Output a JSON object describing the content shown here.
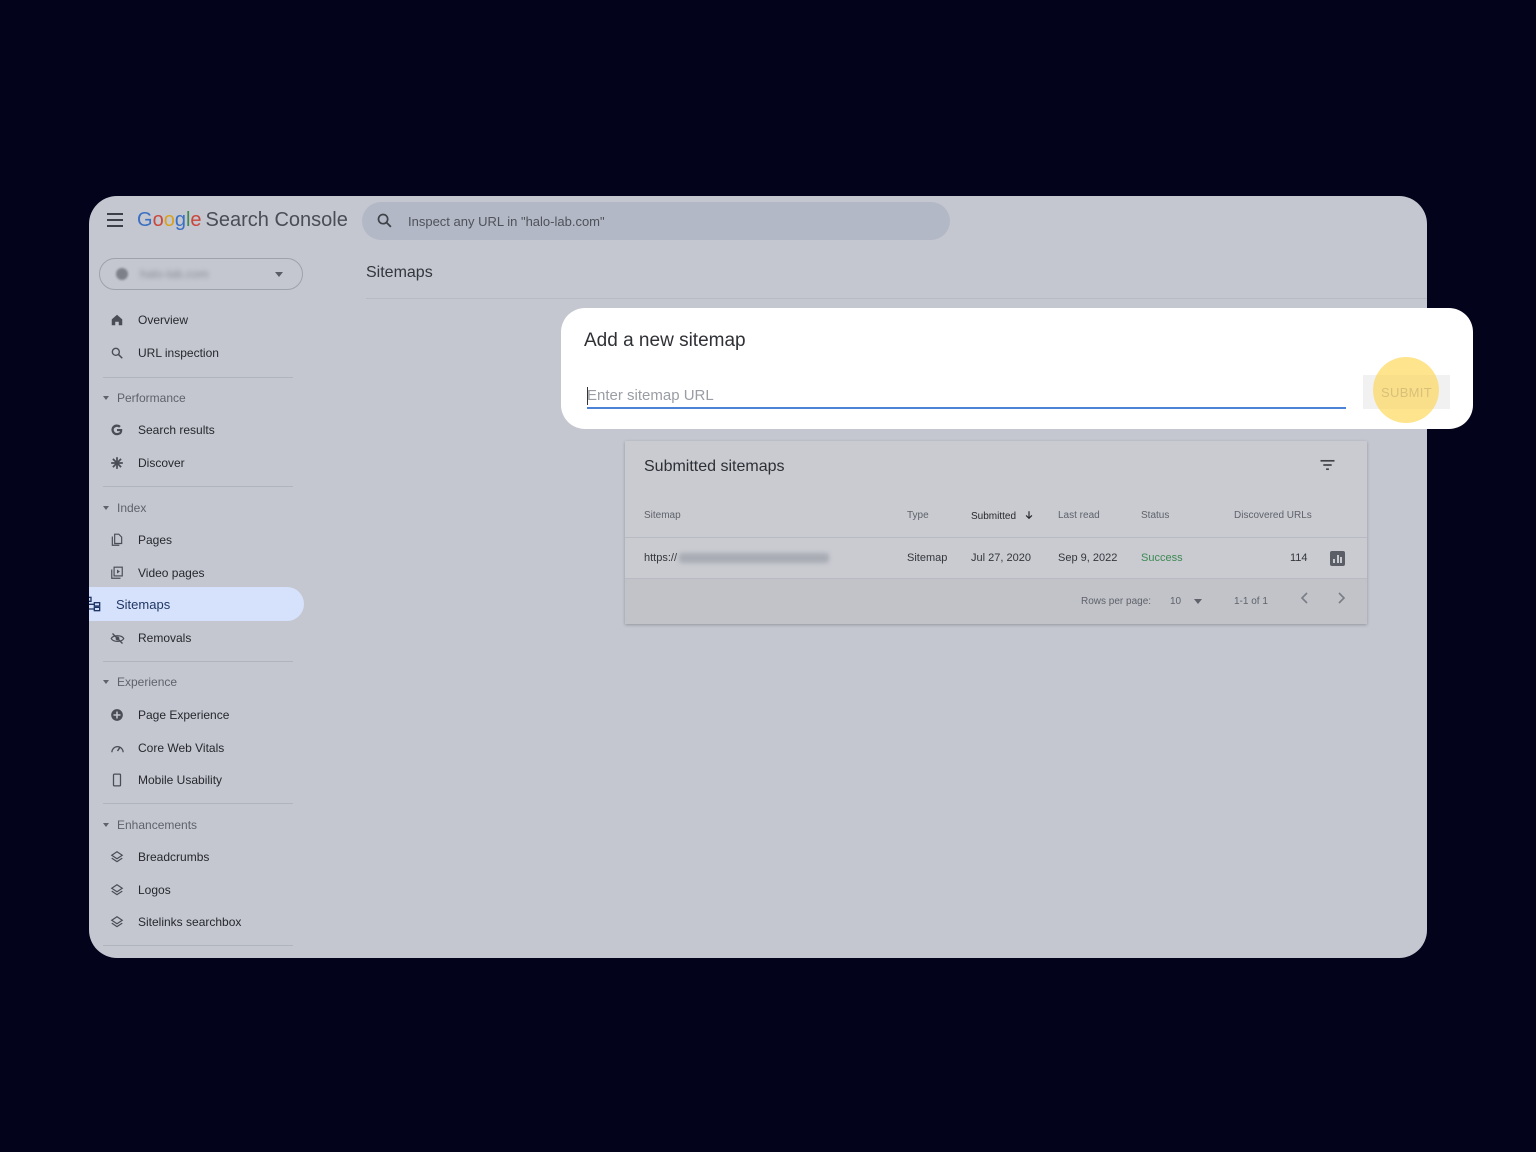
{
  "header": {
    "logo_google_letters": [
      "G",
      "o",
      "o",
      "g",
      "l",
      "e"
    ],
    "logo_product": "Search Console",
    "search_placeholder": "Inspect any URL in \"halo-lab.com\""
  },
  "property": {
    "domain": "halo-lab.com"
  },
  "sidebar": {
    "top_items": [
      {
        "label": "Overview",
        "icon": "home-icon"
      },
      {
        "label": "URL inspection",
        "icon": "search-icon"
      }
    ],
    "sections": [
      {
        "title": "Performance",
        "items": [
          {
            "label": "Search results",
            "icon": "google-g-icon"
          },
          {
            "label": "Discover",
            "icon": "asterisk-icon"
          }
        ]
      },
      {
        "title": "Index",
        "items": [
          {
            "label": "Pages",
            "icon": "pages-icon"
          },
          {
            "label": "Video pages",
            "icon": "video-pages-icon"
          },
          {
            "label": "Sitemaps",
            "icon": "sitemap-icon",
            "active": true
          },
          {
            "label": "Removals",
            "icon": "eye-off-icon"
          }
        ]
      },
      {
        "title": "Experience",
        "items": [
          {
            "label": "Page Experience",
            "icon": "plus-circle-icon"
          },
          {
            "label": "Core Web Vitals",
            "icon": "gauge-icon"
          },
          {
            "label": "Mobile Usability",
            "icon": "phone-icon"
          }
        ]
      },
      {
        "title": "Enhancements",
        "items": [
          {
            "label": "Breadcrumbs",
            "icon": "layers-icon"
          },
          {
            "label": "Logos",
            "icon": "layers-icon"
          },
          {
            "label": "Sitelinks searchbox",
            "icon": "layers-icon"
          }
        ]
      }
    ]
  },
  "main": {
    "page_title": "Sitemaps"
  },
  "dialog": {
    "title": "Add a new sitemap",
    "input_placeholder": "Enter sitemap URL",
    "input_value": "",
    "submit_label": "SUBMIT"
  },
  "submitted": {
    "title": "Submitted sitemaps",
    "columns": [
      "Sitemap",
      "Type",
      "Submitted",
      "Last read",
      "Status",
      "Discovered URLs"
    ],
    "rows": [
      {
        "sitemap": "https://",
        "type": "Sitemap",
        "submitted": "Jul 27, 2020",
        "last_read": "Sep 9, 2022",
        "status": "Success",
        "discovered": "114"
      }
    ],
    "rows_per_page_label": "Rows per page:",
    "rows_per_page_value": "10",
    "range": "1-1 of 1"
  },
  "colors": {
    "background": "#03041c",
    "window": "#c4c7d0",
    "active_nav": "#d6e2fb",
    "accent_blue": "#4d83d6",
    "success_green": "#3c8a52",
    "submit_highlight": "#ffd652"
  }
}
